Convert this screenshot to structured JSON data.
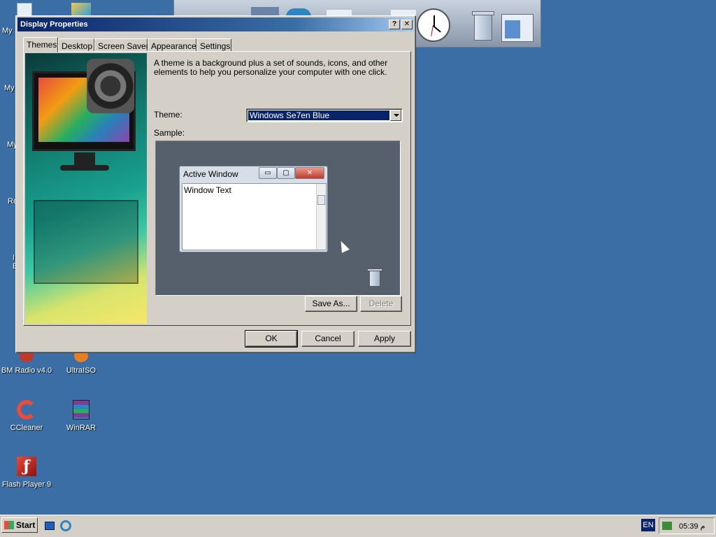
{
  "desktop": {
    "partial_labels": [
      "My",
      "My",
      "My",
      "Re",
      "I",
      "E"
    ],
    "icons": [
      {
        "label": "BM Radio v4.0"
      },
      {
        "label": "UltraISO"
      },
      {
        "label": "CCleaner"
      },
      {
        "label": "WinRAR"
      },
      {
        "label": "Flash Player 9"
      }
    ]
  },
  "window": {
    "title": "Display Properties",
    "help_glyph": "?",
    "close_glyph": "✕",
    "tabs": [
      "Themes",
      "Desktop",
      "Screen Saver",
      "Appearance",
      "Settings"
    ],
    "description": "A theme is a background plus a set of sounds, icons, and other elements to help you personalize your computer with one click.",
    "theme_label": "Theme:",
    "theme_value": "Windows Se7en Blue",
    "sample_label": "Sample:",
    "sample": {
      "active_window_title": "Active Window",
      "window_text": "Window Text",
      "minimize_glyph": "▭",
      "maximize_glyph": "▢",
      "close_glyph": "✕"
    },
    "save_as_label": "Save As...",
    "delete_label": "Delete",
    "ok_label": "OK",
    "cancel_label": "Cancel",
    "apply_label": "Apply"
  },
  "taskbar": {
    "start_label": "Start",
    "language": "EN",
    "clock": "05:39 م"
  },
  "colors": {
    "desktop": "#3a6ea5",
    "titlebar": "#0a246a",
    "face": "#d4d0c8"
  }
}
